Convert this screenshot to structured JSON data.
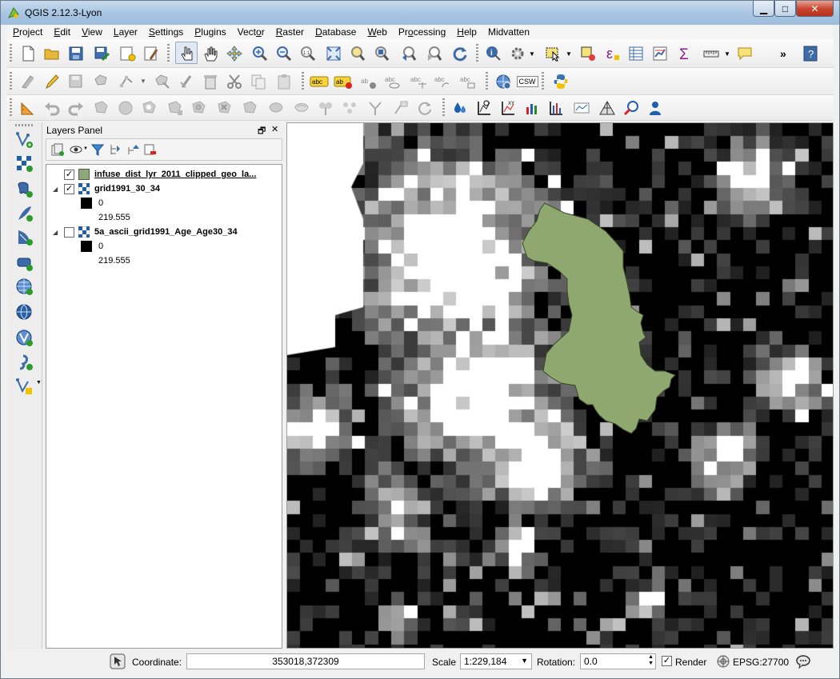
{
  "window": {
    "title": "QGIS 2.12.3-Lyon",
    "min_label": "▁",
    "max_label": "□",
    "close_label": "✕"
  },
  "menubar": [
    {
      "label": "Project",
      "key": "P"
    },
    {
      "label": "Edit",
      "key": "E"
    },
    {
      "label": "View",
      "key": "V"
    },
    {
      "label": "Layer",
      "key": "L"
    },
    {
      "label": "Settings",
      "key": "S"
    },
    {
      "label": "Plugins",
      "key": "P"
    },
    {
      "label": "Vector",
      "key": "o"
    },
    {
      "label": "Raster",
      "key": "R"
    },
    {
      "label": "Database",
      "key": "D"
    },
    {
      "label": "Web",
      "key": "W"
    },
    {
      "label": "Processing",
      "key": "o"
    },
    {
      "label": "Help",
      "key": "H"
    },
    {
      "label": "Midvatten",
      "key": ""
    }
  ],
  "toolbar": {
    "overflow_label": "»",
    "csw_label": "CSW",
    "label_tool_text": "abc"
  },
  "layers_panel": {
    "title": "Layers Panel",
    "float_label": "🗗",
    "close_label": "✕",
    "layers": [
      {
        "name": "infuse_dist_lyr_2011_clipped_geo_la...",
        "checked": true,
        "type": "vector",
        "swatch_color": "#8fa87a"
      },
      {
        "name": "grid1991_30_34",
        "checked": true,
        "type": "raster",
        "legend": [
          {
            "value": "0",
            "color": "#000000"
          },
          {
            "value": "219.555",
            "color": "#ffffff"
          }
        ]
      },
      {
        "name": "5a_ascii_grid1991_Age_Age30_34",
        "checked": false,
        "type": "raster",
        "legend": [
          {
            "value": "0",
            "color": "#000000"
          },
          {
            "value": "219.555",
            "color": "#ffffff"
          }
        ]
      }
    ]
  },
  "map": {
    "polygon_fill": "#8fa870",
    "polygon_stroke": "#3a4a2a"
  },
  "statusbar": {
    "coordinate_label": "Coordinate:",
    "coordinate_value": "353018,372309",
    "scale_label": "Scale",
    "scale_value": "1:229,184",
    "rotation_label": "Rotation:",
    "rotation_value": "0.0",
    "render_label": "Render",
    "render_checked": true,
    "crs_label": "EPSG:27700"
  }
}
